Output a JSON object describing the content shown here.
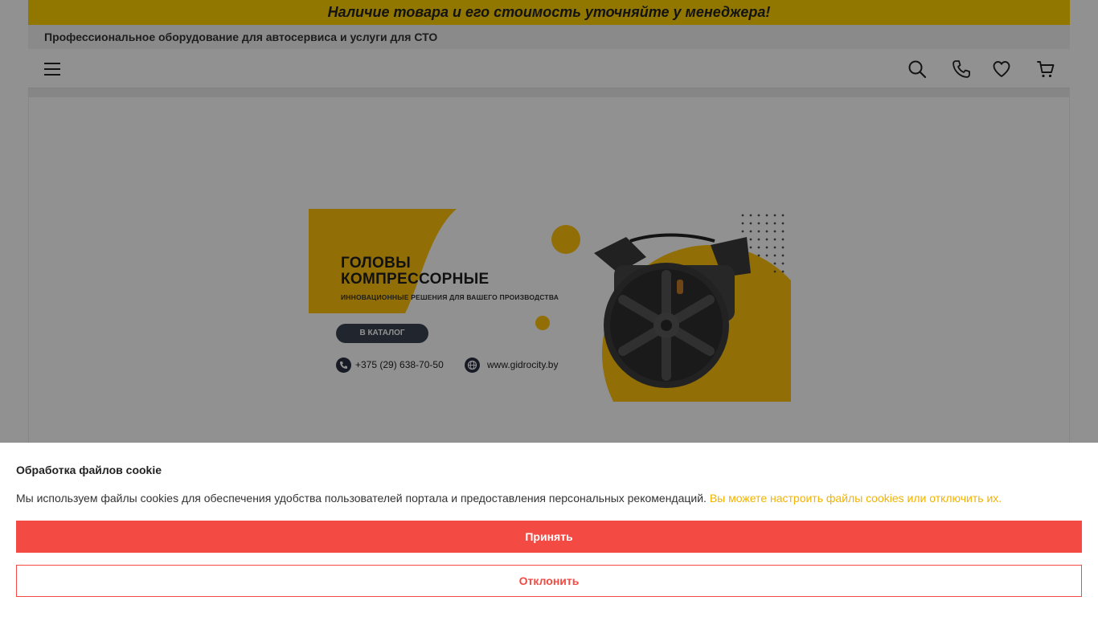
{
  "announcement": "Наличие товара и его стоимость уточняйте у менеджера!",
  "tagline": "Профессиональное оборудование для автосервиса и услуги для СТО",
  "header_icons": [
    "menu-icon",
    "search-icon",
    "phone-icon",
    "heart-icon",
    "cart-icon"
  ],
  "banner": {
    "title_line1": "ГОЛОВЫ",
    "title_line2": "КОМПРЕССОРНЫЕ",
    "subtitle": "ИННОВАЦИОННЫЕ РЕШЕНИЯ ДЛЯ ВАШЕГО ПРОИЗВОДСТВА",
    "button": "В КАТАЛОГ",
    "phone": "+375 (29) 638-70-50",
    "website": "www.gidrocity.by"
  },
  "cookie": {
    "title": "Обработка файлов cookie",
    "text": "Мы используем файлы cookies для обеспечения удобства пользователей портала и предоставления персональных рекомендаций.",
    "link": "Вы можете настроить файлы cookies или отключить их.",
    "accept": "Принять",
    "decline": "Отклонить"
  },
  "colors": {
    "accent_yellow": "#ffd200",
    "accept_red": "#f34a43",
    "link_yellow": "#f2b200",
    "dark": "#2b3142"
  }
}
